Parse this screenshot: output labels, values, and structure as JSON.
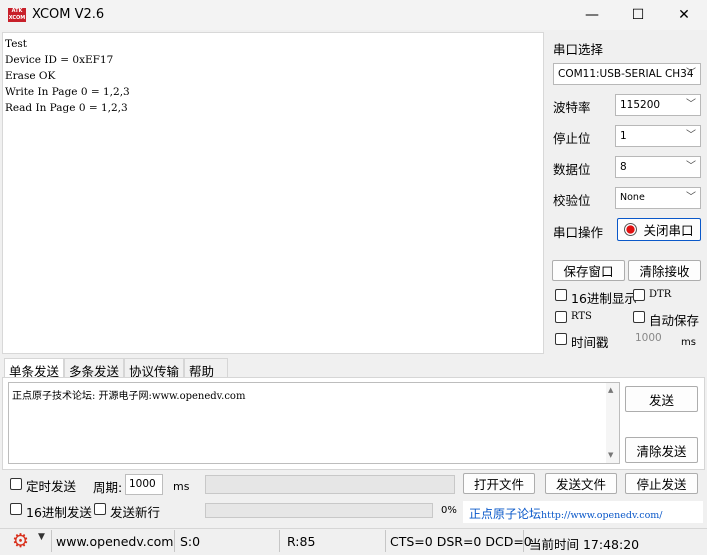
{
  "window": {
    "logo_text": "ATK XCOM",
    "title": "XCOM V2.6",
    "minimize": "—",
    "maximize": "☐",
    "close": "✕"
  },
  "receive": {
    "text": "Test\nDevice ID = 0xEF17\nErase OK\nWrite In Page 0 = 1,2,3\nRead In Page 0 = 1,2,3"
  },
  "serial": {
    "port_select_label": "串口选择",
    "port_value": "COM11:USB-SERIAL CH34",
    "baud_label": "波特率",
    "baud_value": "115200",
    "stopbits_label": "停止位",
    "stopbits_value": "1",
    "databits_label": "数据位",
    "databits_value": "8",
    "parity_label": "校验位",
    "parity_value": "None",
    "operation_label": "串口操作",
    "close_port_button": "关闭串口",
    "save_window_button": "保存窗口",
    "clear_receive_button": "清除接收",
    "hex_display_label": "16进制显示",
    "dtr_label": "DTR",
    "rts_label": "RTS",
    "auto_save_label": "自动保存",
    "timestamp_label": "时间戳",
    "timestamp_value": "1000",
    "timestamp_unit": "ms"
  },
  "tabs": [
    {
      "label": "单条发送"
    },
    {
      "label": "多条发送"
    },
    {
      "label": "协议传输"
    },
    {
      "label": "帮助"
    }
  ],
  "send": {
    "text": "正点原子技术论坛: 开源电子网:www.openedv.com",
    "send_button": "发送",
    "clear_send_button": "清除发送",
    "timed_send_label": "定时发送",
    "period_label": "周期:",
    "period_value": "1000",
    "period_unit": "ms",
    "open_file_button": "打开文件",
    "send_file_button": "发送文件",
    "stop_send_button": "停止发送",
    "hex_send_label": "16进制发送",
    "send_newline_label": "发送新行",
    "progress_text": "0%",
    "progress": 0,
    "forum_label": "正点原子论坛",
    "forum_url": "http://www.openedv.com/"
  },
  "status": {
    "website": "www.openedv.com",
    "sent": "S:0",
    "received": "R:85",
    "lines": "CTS=0 DSR=0 DCD=0",
    "time": "当前时间 17:48:20"
  },
  "colors": {
    "accent": "#0a58c9",
    "record_red": "#e01010",
    "gear_red": "#d9301c"
  }
}
